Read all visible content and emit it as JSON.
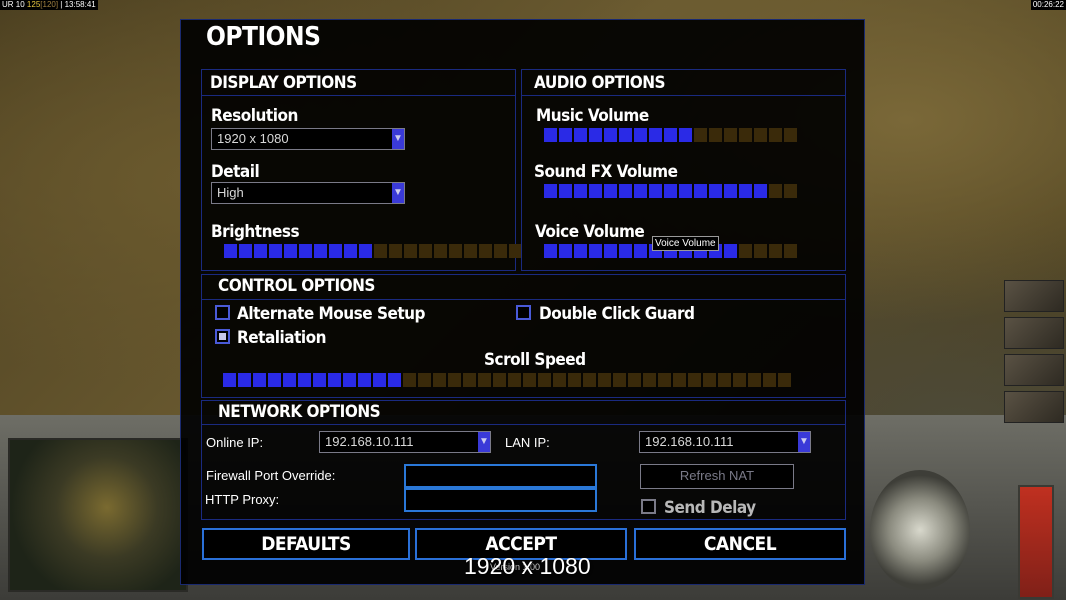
{
  "hud": {
    "top_left_prefix": "UR 10",
    "top_left_money": "125",
    "top_left_cap": "[120]",
    "top_left_time": "13:58:41",
    "top_right_time": "00:26:22"
  },
  "dialog": {
    "title": "OPTIONS",
    "display": {
      "title": "DISPLAY OPTIONS",
      "resolution_label": "Resolution",
      "resolution_value": "1920 x 1080",
      "detail_label": "Detail",
      "detail_value": "High",
      "brightness_label": "Brightness",
      "brightness_level": 10,
      "brightness_total": 20
    },
    "audio": {
      "title": "AUDIO OPTIONS",
      "music_label": "Music Volume",
      "music_level": 10,
      "music_total": 17,
      "sfx_label": "Sound FX Volume",
      "sfx_level": 15,
      "sfx_total": 17,
      "voice_label": "Voice Volume",
      "voice_level": 13,
      "voice_total": 17,
      "tooltip": "Voice Volume"
    },
    "control": {
      "title": "CONTROL OPTIONS",
      "alt_mouse_label": "Alternate Mouse Setup",
      "alt_mouse_checked": false,
      "double_click_label": "Double Click Guard",
      "double_click_checked": false,
      "retaliation_label": "Retaliation",
      "retaliation_checked": true,
      "scroll_label": "Scroll Speed",
      "scroll_level": 12,
      "scroll_total": 38
    },
    "network": {
      "title": "NETWORK OPTIONS",
      "online_ip_label": "Online IP:",
      "online_ip_value": "192.168.10.111",
      "lan_ip_label": "LAN IP:",
      "lan_ip_value": "192.168.10.111",
      "firewall_label": "Firewall Port Override:",
      "firewall_value": "",
      "proxy_label": "HTTP Proxy:",
      "proxy_value": "",
      "refresh_nat_label": "Refresh NAT",
      "send_delay_label": "Send Delay",
      "send_delay_checked": false
    },
    "buttons": {
      "defaults": "DEFAULTS",
      "accept": "ACCEPT",
      "cancel": "CANCEL"
    },
    "version": "Version 1.00",
    "resolution_overlay": "1920 x 1080"
  },
  "colors": {
    "accent_blue": "#2a2ae6",
    "border_blue": "#1a2a80",
    "button_border": "#2a70d8"
  }
}
